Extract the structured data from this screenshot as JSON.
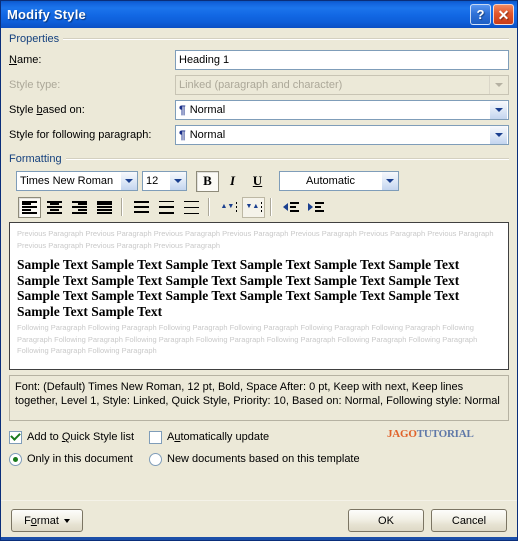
{
  "titlebar": {
    "title": "Modify Style",
    "help_label": "?",
    "close_label": "✕"
  },
  "properties": {
    "group_label": "Properties",
    "name_label": "Name:",
    "name_value": "Heading 1",
    "style_type_label": "Style type:",
    "style_type_value": "Linked (paragraph and character)",
    "based_on_label": "Style based on:",
    "based_on_value": "Normal",
    "following_label": "Style for following paragraph:",
    "following_value": "Normal",
    "pilcrow": "¶"
  },
  "formatting": {
    "group_label": "Formatting",
    "font_name": "Times New Roman",
    "font_size": "12",
    "bold_label": "B",
    "italic_label": "I",
    "underline_label": "U",
    "font_color": "Automatic",
    "align_left": "Align Left",
    "align_center": "Center",
    "align_right": "Align Right",
    "align_justify": "Justify",
    "line_spacing_single": "Single Spacing",
    "line_spacing_15": "1.5 Spacing",
    "line_spacing_double": "Double Spacing",
    "spacing_decrease": "Decrease Paragraph Spacing",
    "spacing_increase": "Increase Paragraph Spacing",
    "indent_decrease": "Decrease Indent",
    "indent_increase": "Increase Indent"
  },
  "preview": {
    "previous_paragraph": "Previous Paragraph Previous Paragraph Previous Paragraph Previous Paragraph Previous Paragraph Previous Paragraph Previous Paragraph Previous Paragraph Previous Paragraph Previous Paragraph",
    "sample_text": "Sample Text Sample Text Sample Text Sample Text Sample Text Sample Text Sample Text Sample Text Sample Text Sample Text Sample Text Sample Text Sample Text Sample Text Sample Text Sample Text Sample Text Sample Text Sample Text Sample Text",
    "following_paragraph": "Following Paragraph Following Paragraph Following Paragraph Following Paragraph Following Paragraph Following Paragraph Following Paragraph Following Paragraph Following Paragraph Following Paragraph Following Paragraph Following Paragraph Following Paragraph Following Paragraph Following Paragraph"
  },
  "description": "Font: (Default) Times New Roman, 12 pt, Bold, Space After:  0 pt, Keep with next, Keep lines together, Level 1, Style: Linked, Quick Style, Priority: 10, Based on: Normal, Following style: Normal",
  "options": {
    "add_quick_style_label": "Add to Quick Style list",
    "add_quick_style_checked": true,
    "auto_update_label": "Automatically update",
    "auto_update_checked": false,
    "only_this_document_label": "Only in this document",
    "only_this_document_selected": true,
    "new_documents_label": "New documents based on this template",
    "new_documents_selected": false
  },
  "watermark": {
    "part1": "JAGO",
    "part2": "TUTORIAL"
  },
  "footer": {
    "format_label": "Format",
    "ok_label": "OK",
    "cancel_label": "Cancel"
  },
  "colors": {
    "titlebar_blue": "#1268e4",
    "dialog_face": "#ece9d8",
    "group_label_blue": "#15417e",
    "field_border": "#7f9db9",
    "watermark_orange": "#e0622a",
    "watermark_blue": "#5f78a8",
    "bottom_rule": "#1c4fa8"
  }
}
